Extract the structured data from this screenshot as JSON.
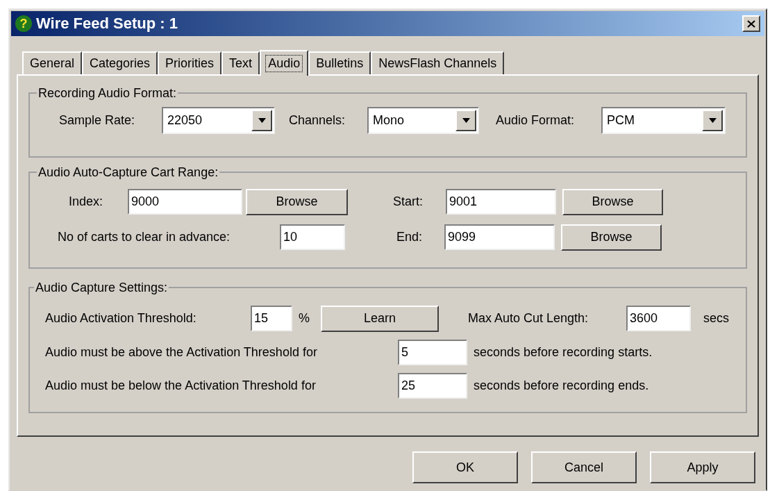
{
  "window": {
    "title": "Wire Feed Setup : 1",
    "help_glyph": "?"
  },
  "tabs": [
    {
      "label": "General",
      "selected": false
    },
    {
      "label": "Categories",
      "selected": false
    },
    {
      "label": "Priorities",
      "selected": false
    },
    {
      "label": "Text",
      "selected": false
    },
    {
      "label": "Audio",
      "selected": true
    },
    {
      "label": "Bulletins",
      "selected": false
    },
    {
      "label": "NewsFlash Channels",
      "selected": false
    }
  ],
  "recording_format": {
    "title": "Recording Audio Format:",
    "dropdowns": [
      {
        "label": "Sample Rate:",
        "value": "22050"
      },
      {
        "label": "Channels:",
        "value": "Mono"
      },
      {
        "label": "Audio Format:",
        "value": "PCM"
      }
    ]
  },
  "cart_range": {
    "title": "Audio Auto-Capture Cart Range:",
    "index": {
      "label": "Index:",
      "value": "9000",
      "button": "Browse"
    },
    "clear_in_advance": {
      "label": "No of carts to clear in advance:",
      "value": "10"
    },
    "start": {
      "label": "Start:",
      "value": "9001",
      "button": "Browse"
    },
    "end": {
      "label": "End:",
      "value": "9099",
      "button": "Browse"
    }
  },
  "capture_settings": {
    "title": "Audio Capture Settings:",
    "threshold": {
      "label": "Audio Activation Threshold:",
      "value": "15",
      "unit": "%",
      "button": "Learn"
    },
    "max_cut_length": {
      "label": "Max Auto Cut Length:",
      "value": "3600",
      "unit": "secs"
    },
    "above": {
      "label": "Audio must be above the Activation Threshold for",
      "value": "5",
      "suffix": "seconds before recording starts."
    },
    "below": {
      "label": "Audio must be below the Activation Threshold for",
      "value": "25",
      "suffix": "seconds before recording ends."
    }
  },
  "buttons": [
    "OK",
    "Cancel",
    "Apply"
  ]
}
